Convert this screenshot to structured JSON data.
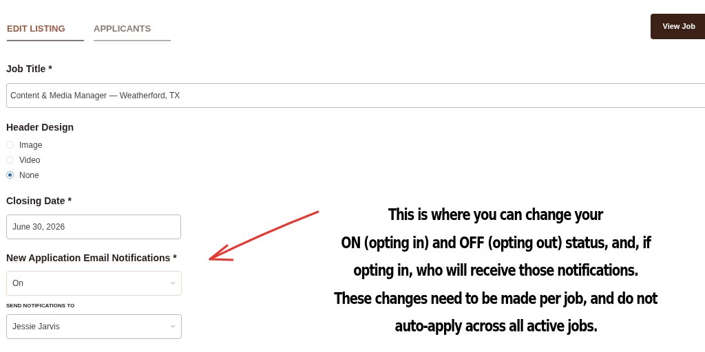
{
  "tabs": [
    {
      "label": "EDIT LISTING",
      "selected": true
    },
    {
      "label": "APPLICANTS",
      "selected": false
    }
  ],
  "view_job_button": "View Job",
  "form": {
    "job_title": {
      "label": "Job Title *",
      "value": "Content & Media Manager — Weatherford, TX"
    },
    "header_design": {
      "label": "Header Design",
      "options": [
        {
          "label": "Image",
          "selected": false
        },
        {
          "label": "Video",
          "selected": false
        },
        {
          "label": "None",
          "selected": true
        }
      ]
    },
    "closing_date": {
      "label": "Closing Date *",
      "value": "June 30, 2026"
    },
    "notifications": {
      "label": "New Application Email Notifications *",
      "value": "On"
    },
    "send_to": {
      "label": "SEND NOTIFICATIONS TO",
      "value": "Jessie Jarvis"
    }
  },
  "annotation": {
    "lines": [
      "This is where you can change your",
      "ON (opting in) and OFF (opting out) status, and, if",
      "opting in, who will receive those notifications.",
      "These changes need to be made per job, and do not",
      "auto-apply across all active jobs."
    ]
  }
}
